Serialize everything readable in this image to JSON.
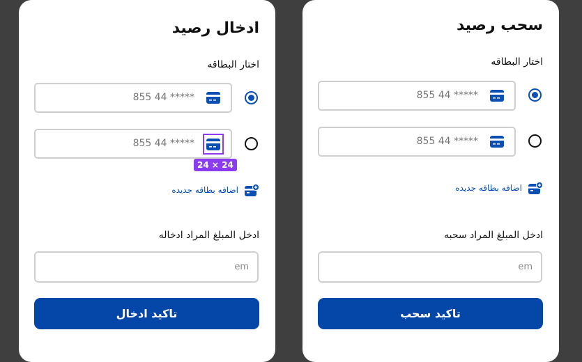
{
  "colors": {
    "accent": "#0447a8",
    "selection_outline": "#8b3cf0"
  },
  "deposit": {
    "title": "ادخال رصيد",
    "choose_card": "اختار البطاقه",
    "cards": [
      {
        "number": "855 44  *****",
        "selected": true,
        "icon": "credit-card-icon"
      },
      {
        "number": "855 44  *****",
        "selected": false,
        "icon": "credit-card-icon"
      }
    ],
    "dimension_badge": "24 × 24",
    "add_card": "اضافه بطاقه جديده",
    "amount_label": "ادخل المبلغ المراد ادخاله",
    "amount_placeholder": "em",
    "amount_value": "",
    "confirm": "تاكيد ادخال"
  },
  "withdraw": {
    "title": "سحب رصيد",
    "choose_card": "اختار البطاقه",
    "cards": [
      {
        "number": "855 44  *****",
        "selected": true,
        "icon": "credit-card-icon"
      },
      {
        "number": "855 44  *****",
        "selected": false,
        "icon": "credit-card-icon"
      }
    ],
    "add_card": "اضافه بطاقه جديده",
    "amount_label": "ادخل المبلغ المراد سحبه",
    "amount_placeholder": "em",
    "amount_value": "",
    "confirm": "تاكيد سحب"
  }
}
